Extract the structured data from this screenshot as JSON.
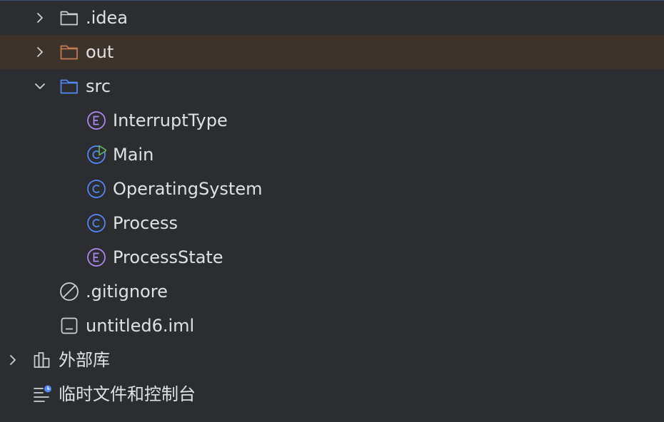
{
  "project_tree": {
    "nodes": [
      {
        "label": ".idea",
        "icon": "folder-icon",
        "expandable": true,
        "expanded": false,
        "depth": 1,
        "excluded": false
      },
      {
        "label": "out",
        "icon": "excluded-folder-icon",
        "expandable": true,
        "expanded": false,
        "depth": 1,
        "excluded": true
      },
      {
        "label": "src",
        "icon": "source-folder-icon",
        "expandable": true,
        "expanded": true,
        "depth": 1,
        "excluded": false
      },
      {
        "label": "InterruptType",
        "icon": "enum-icon",
        "depth": 2
      },
      {
        "label": "Main",
        "icon": "runnable-class-icon",
        "depth": 2
      },
      {
        "label": "OperatingSystem",
        "icon": "class-icon",
        "depth": 2
      },
      {
        "label": "Process",
        "icon": "class-icon",
        "depth": 2
      },
      {
        "label": "ProcessState",
        "icon": "enum-icon",
        "depth": 2
      },
      {
        "label": ".gitignore",
        "icon": "ignore-file-icon",
        "depth": 1
      },
      {
        "label": "untitled6.iml",
        "icon": "module-file-icon",
        "depth": 1
      },
      {
        "label": "外部库",
        "icon": "library-icon",
        "expandable": true,
        "expanded": false,
        "depth": 0
      },
      {
        "label": "临时文件和控制台",
        "icon": "scratches-icon",
        "depth": 0
      }
    ]
  },
  "colors": {
    "background": "#2b2d30",
    "excluded_row": "#3e332a",
    "text": "#dfe1e5",
    "folder_gray": "#ced0d6",
    "folder_orange": "#c77d55",
    "folder_blue": "#548af7",
    "enum_purple": "#b189f5",
    "class_blue": "#548af7",
    "run_green": "#5fb865"
  }
}
